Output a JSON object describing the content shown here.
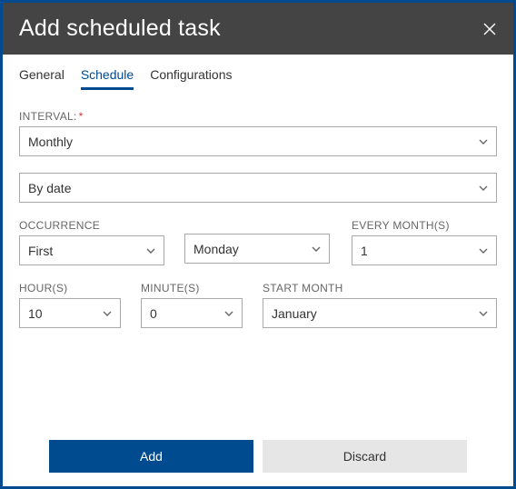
{
  "header": {
    "title": "Add scheduled task"
  },
  "tabs": {
    "general": "General",
    "schedule": "Schedule",
    "configurations": "Configurations"
  },
  "labels": {
    "interval": "INTERVAL:",
    "occurrence": "OCCURRENCE",
    "every_months": "EVERY MONTH(S)",
    "hours": "HOUR(S)",
    "minutes": "MINUTE(S)",
    "start_month": "START MONTH"
  },
  "values": {
    "interval": "Monthly",
    "by_date": "By date",
    "occurrence": "First",
    "day_of_week": "Monday",
    "every_months": "1",
    "hours": "10",
    "minutes": "0",
    "start_month": "January"
  },
  "buttons": {
    "add": "Add",
    "discard": "Discard"
  }
}
